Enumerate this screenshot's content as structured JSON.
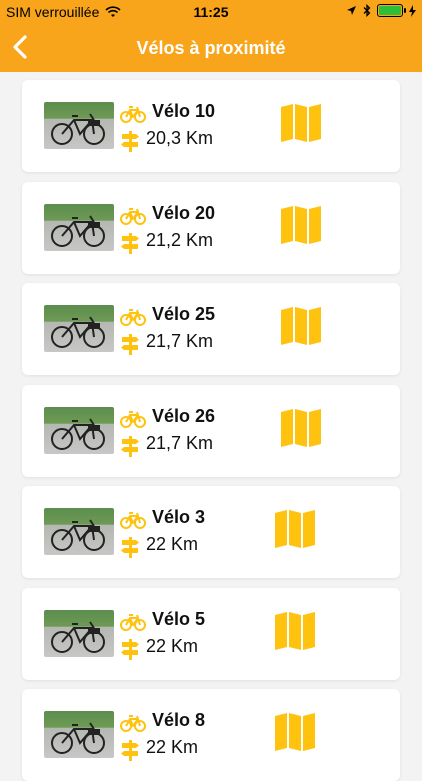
{
  "status_bar": {
    "carrier": "SIM verrouillée",
    "time": "11:25"
  },
  "header": {
    "title": "Vélos à proximité"
  },
  "colors": {
    "accent": "#f9a51b",
    "icon_yellow": "#ffc20e"
  },
  "bikes": [
    {
      "name": "Vélo 10",
      "distance": "20,3 Km"
    },
    {
      "name": "Vélo 20",
      "distance": "21,2 Km"
    },
    {
      "name": "Vélo 25",
      "distance": "21,7 Km"
    },
    {
      "name": "Vélo 26",
      "distance": "21,7 Km"
    },
    {
      "name": "Vélo 3",
      "distance": "22 Km"
    },
    {
      "name": "Vélo 5",
      "distance": "22 Km"
    },
    {
      "name": "Vélo 8",
      "distance": "22 Km"
    }
  ]
}
